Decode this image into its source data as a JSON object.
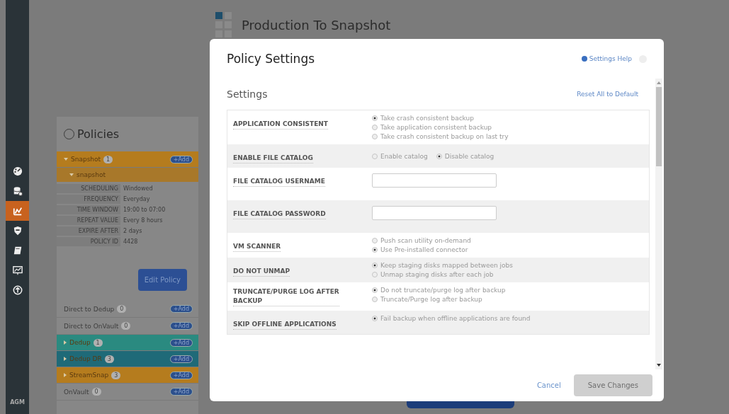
{
  "nav": {
    "items": [
      {
        "kind": "gauge",
        "selected": false
      },
      {
        "kind": "database",
        "selected": false
      },
      {
        "kind": "chart",
        "selected": true
      },
      {
        "kind": "shield",
        "selected": false
      },
      {
        "kind": "book",
        "selected": false
      },
      {
        "kind": "monitor",
        "selected": false
      },
      {
        "kind": "upload",
        "selected": false
      }
    ],
    "footer": "AGM"
  },
  "page": {
    "title": "Production To Snapshot"
  },
  "policies": {
    "title": "Policies",
    "groups": [
      {
        "kind": "folder",
        "label": "Snapshot",
        "count": "1",
        "add": "+Add",
        "color": "#b57c1e",
        "expanded": true,
        "children": [
          {
            "label": "snapshot",
            "expanded": true,
            "details": [
              {
                "key": "SCHEDULING",
                "value": "Windowed"
              },
              {
                "key": "FREQUENCY",
                "value": "Everyday"
              },
              {
                "key": "TIME WINDOW",
                "value": "19:00 to 07:00"
              },
              {
                "key": "REPEAT VALUE",
                "value": "Every 8 hours"
              },
              {
                "key": "EXPIRE AFTER",
                "value": "2 days"
              },
              {
                "key": "POLICY ID",
                "value": "4428"
              }
            ],
            "action": "Edit Policy"
          }
        ]
      },
      {
        "kind": "plain",
        "label": "Direct to Dedup",
        "count": "0",
        "add": "+Add"
      },
      {
        "kind": "plain",
        "label": "Direct to OnVault",
        "count": "0",
        "add": "+Add"
      },
      {
        "kind": "folder",
        "label": "Dedup",
        "count": "1",
        "add": "+Add",
        "color": "#2a8a80",
        "expanded": false
      },
      {
        "kind": "folder",
        "label": "Dedup DR",
        "count": "3",
        "add": "+Add",
        "color": "#1f6a78",
        "expanded": false
      },
      {
        "kind": "folder",
        "label": "StreamSnap",
        "count": "3",
        "add": "+Add",
        "color": "#b57c1e",
        "expanded": false
      },
      {
        "kind": "plain",
        "label": "OnVault",
        "count": "0",
        "add": "+Add"
      }
    ]
  },
  "dialog": {
    "title": "Policy Settings",
    "help": "Settings Help",
    "section": "Settings",
    "reset": "Reset All to Default",
    "rows": [
      {
        "kind": "radio",
        "label": "APPLICATION CONSISTENT",
        "options": [
          {
            "label": "Take crash consistent backup",
            "selected": true
          },
          {
            "label": "Take application consistent backup",
            "selected": false
          },
          {
            "label": "Take crash consistent backup on last try",
            "selected": false
          }
        ]
      },
      {
        "kind": "radio-inline",
        "label": "ENABLE FILE CATALOG",
        "options": [
          {
            "label": "Enable catalog",
            "selected": false
          },
          {
            "label": "Disable catalog",
            "selected": true
          }
        ]
      },
      {
        "kind": "text",
        "label": "FILE CATALOG USERNAME"
      },
      {
        "kind": "text",
        "label": "FILE CATALOG PASSWORD"
      },
      {
        "kind": "radio",
        "label": "VM SCANNER",
        "options": [
          {
            "label": "Push scan utility on-demand",
            "selected": false
          },
          {
            "label": "Use Pre-installed connector",
            "selected": true
          }
        ]
      },
      {
        "kind": "radio",
        "label": "DO NOT UNMAP",
        "options": [
          {
            "label": "Keep staging disks mapped between jobs",
            "selected": true
          },
          {
            "label": "Unmap staging disks after each job",
            "selected": false
          }
        ]
      },
      {
        "kind": "radio",
        "label": "TRUNCATE/PURGE LOG AFTER BACKUP",
        "options": [
          {
            "label": "Do not truncate/purge log after backup",
            "selected": true
          },
          {
            "label": "Truncate/Purge log after backup",
            "selected": false
          }
        ]
      },
      {
        "kind": "radio",
        "label": "SKIP OFFLINE APPLICATIONS",
        "options": [
          {
            "label": "Fail backup when offline applications are found",
            "selected": true
          }
        ]
      }
    ],
    "cancel": "Cancel",
    "save": {
      "label": "Save Changes",
      "disabled": true
    }
  }
}
